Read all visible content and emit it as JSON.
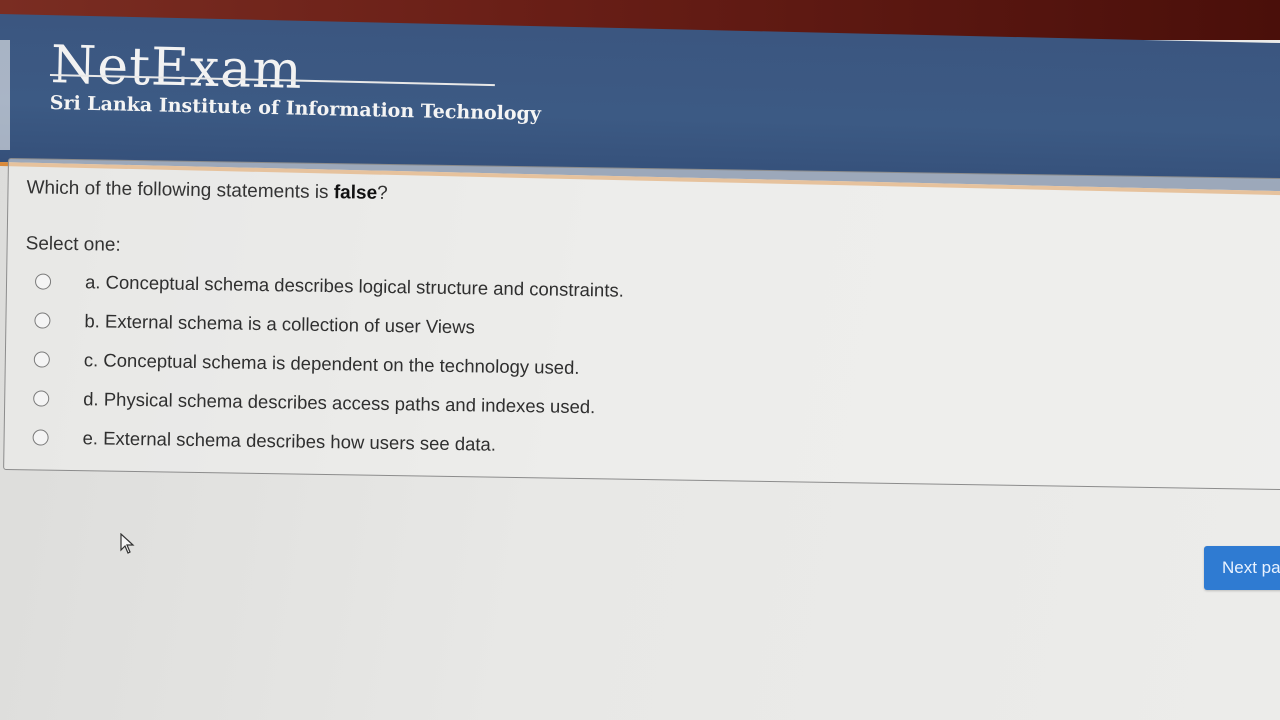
{
  "header": {
    "logo": "NetExam",
    "institute": "Sri Lanka Institute of Information Technology"
  },
  "question": {
    "prefix": "Which of the following statements is ",
    "emphasis": "false",
    "suffix": "?",
    "select_label": "Select one:",
    "options": [
      {
        "label": "a. Conceptual schema describes logical structure and constraints.",
        "selected": false
      },
      {
        "label": "b. External schema is a collection of user Views",
        "selected": false
      },
      {
        "label": "c. Conceptual schema is dependent on the technology used.",
        "selected": false
      },
      {
        "label": "d. Physical schema describes access paths and indexes used.",
        "selected": false
      },
      {
        "label": "e. External schema describes how users see data.",
        "selected": false
      }
    ]
  },
  "navigation": {
    "next_label": "Next page"
  },
  "colors": {
    "header_bg": "#3c5a84",
    "accent_stripe": "#d98a3a",
    "button_bg": "#2f7bd2"
  }
}
